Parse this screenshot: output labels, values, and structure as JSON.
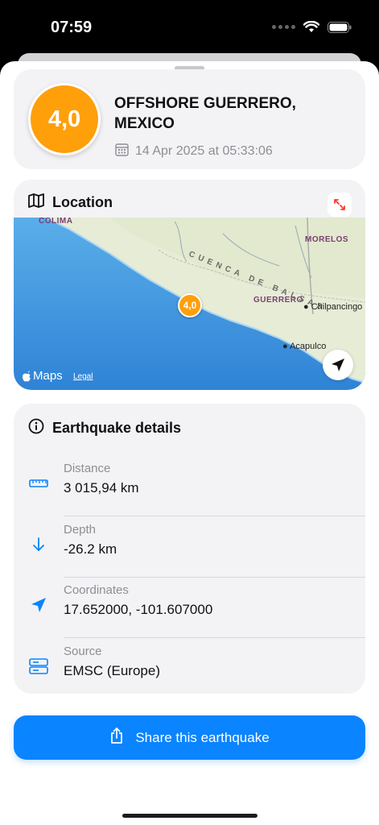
{
  "status_bar": {
    "time": "07:59"
  },
  "header": {
    "magnitude": "4,0",
    "place": "OFFSHORE GUERRERO, MEXICO",
    "date": "14 Apr 2025 at 05:33:06",
    "magnitude_color": "#ff9f0a"
  },
  "location": {
    "title": "Location",
    "map": {
      "pin_label": "4,0",
      "region_labels": [
        "COLIMA",
        "MORELOS",
        "GUERRERO"
      ],
      "feature_label": "CUENCA DE BALSAS",
      "cities": [
        "Chilpancingo",
        "Acapulco"
      ],
      "provider": "Maps",
      "legal": "Legal"
    }
  },
  "details": {
    "title": "Earthquake details",
    "rows": [
      {
        "label": "Distance",
        "value": "3 015,94 km",
        "icon": "ruler-icon"
      },
      {
        "label": "Depth",
        "value": "-26.2 km",
        "icon": "arrow-down-icon"
      },
      {
        "label": "Coordinates",
        "value": "17.652000, -101.607000",
        "icon": "location-arrow-icon"
      },
      {
        "label": "Source",
        "value": "EMSC (Europe)",
        "icon": "server-icon"
      }
    ]
  },
  "share": {
    "label": "Share this earthquake"
  },
  "colors": {
    "accent": "#0a84ff",
    "magnitude": "#ff9f0a",
    "expand_icon": "#ff3b30"
  }
}
